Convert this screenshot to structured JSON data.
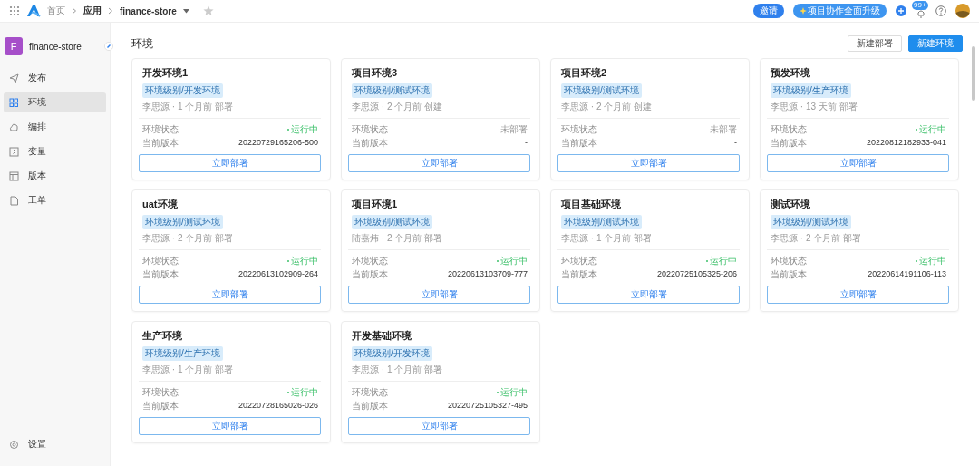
{
  "topbar": {
    "breadcrumb": [
      "首页",
      "应用",
      "finance-store"
    ],
    "invite": "邀请",
    "upgrade": "项目协作全面升级",
    "notifications": "99+"
  },
  "sidebar": {
    "app_initial": "F",
    "app_name": "finance-store",
    "items": [
      {
        "label": "发布",
        "selected": false
      },
      {
        "label": "环境",
        "selected": true
      },
      {
        "label": "编排",
        "selected": false
      },
      {
        "label": "变量",
        "selected": false
      },
      {
        "label": "版本",
        "selected": false
      },
      {
        "label": "工单",
        "selected": false
      }
    ],
    "footer": "设置"
  },
  "page": {
    "title": "环境",
    "buttons": [
      {
        "label": "新建部署",
        "kind": "default"
      },
      {
        "label": "新建环境",
        "kind": "primary"
      }
    ]
  },
  "cards": [
    {
      "title": "开发环境1",
      "tag": "环境级别/开发环境",
      "meta": "李思源 · 1 个月前 部署",
      "status_label": "环境状态",
      "status": "运行中",
      "running": true,
      "version_label": "当前版本",
      "version": "20220729165206-500",
      "action": "立即部署"
    },
    {
      "title": "项目环境3",
      "tag": "环境级别/测试环境",
      "meta": "李思源 · 2 个月前 创建",
      "status_label": "环境状态",
      "status": "未部署",
      "running": false,
      "version_label": "当前版本",
      "version": "-",
      "action": "立即部署"
    },
    {
      "title": "项目环境2",
      "tag": "环境级别/测试环境",
      "meta": "李思源 · 2 个月前 创建",
      "status_label": "环境状态",
      "status": "未部署",
      "running": false,
      "version_label": "当前版本",
      "version": "-",
      "action": "立即部署"
    },
    {
      "title": "预发环境",
      "tag": "环境级别/生产环境",
      "meta": "李思源 · 13 天前 部署",
      "status_label": "环境状态",
      "status": "运行中",
      "running": true,
      "version_label": "当前版本",
      "version": "20220812182933-041",
      "action": "立即部署"
    },
    {
      "title": "uat环境",
      "tag": "环境级别/测试环境",
      "meta": "李思源 · 2 个月前 部署",
      "status_label": "环境状态",
      "status": "运行中",
      "running": true,
      "version_label": "当前版本",
      "version": "20220613102909-264",
      "action": "立即部署"
    },
    {
      "title": "项目环境1",
      "tag": "环境级别/测试环境",
      "meta": "陆嘉炜 · 2 个月前 部署",
      "status_label": "环境状态",
      "status": "运行中",
      "running": true,
      "version_label": "当前版本",
      "version": "20220613103709-777",
      "action": "立即部署"
    },
    {
      "title": "项目基础环境",
      "tag": "环境级别/测试环境",
      "meta": "李思源 · 1 个月前 部署",
      "status_label": "环境状态",
      "status": "运行中",
      "running": true,
      "version_label": "当前版本",
      "version": "20220725105325-206",
      "action": "立即部署"
    },
    {
      "title": "测试环境",
      "tag": "环境级别/测试环境",
      "meta": "李思源 · 2 个月前 部署",
      "status_label": "环境状态",
      "status": "运行中",
      "running": true,
      "version_label": "当前版本",
      "version": "20220614191106-113",
      "action": "立即部署"
    },
    {
      "title": "生产环境",
      "tag": "环境级别/生产环境",
      "meta": "李思源 · 1 个月前 部署",
      "status_label": "环境状态",
      "status": "运行中",
      "running": true,
      "version_label": "当前版本",
      "version": "20220728165026-026",
      "action": "立即部署"
    },
    {
      "title": "开发基础环境",
      "tag": "环境级别/开发环境",
      "meta": "李思源 · 1 个月前 部署",
      "status_label": "环境状态",
      "status": "运行中",
      "running": true,
      "version_label": "当前版本",
      "version": "20220725105327-495",
      "action": "立即部署"
    }
  ]
}
